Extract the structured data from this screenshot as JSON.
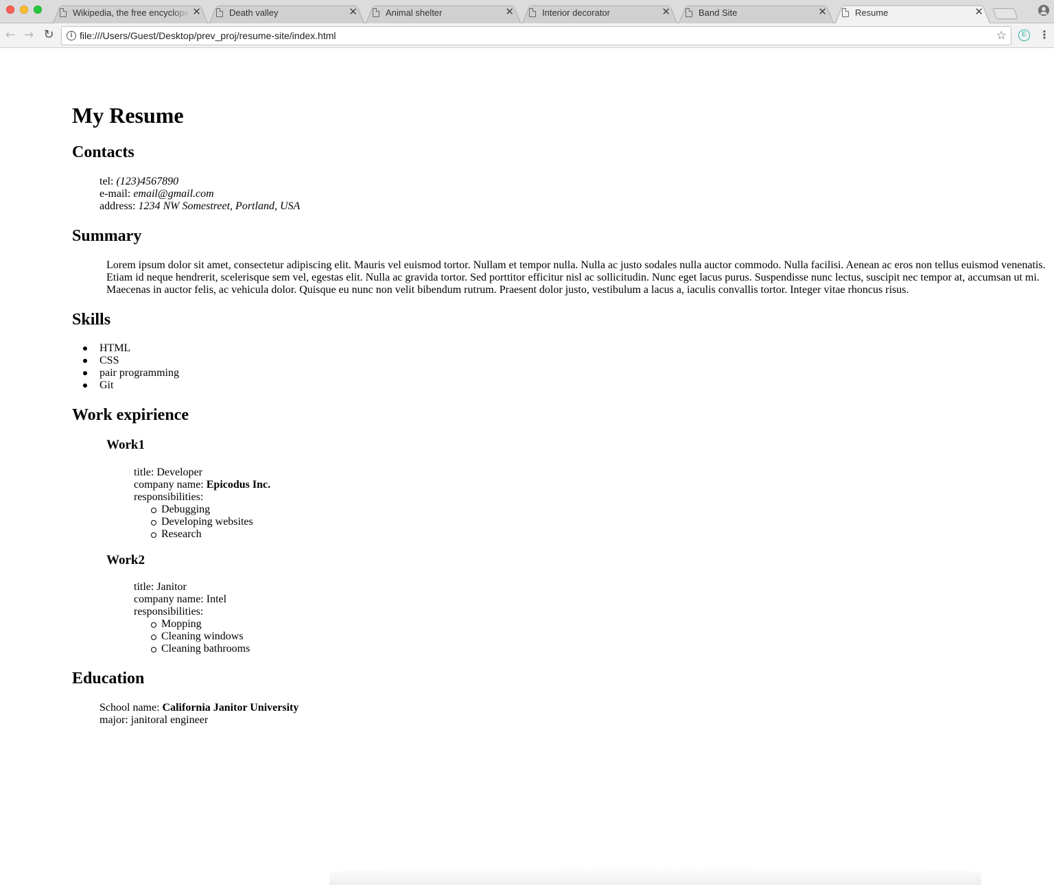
{
  "browser": {
    "tabs": [
      {
        "title": "Wikipedia, the free encyclopedia",
        "active": false
      },
      {
        "title": "Death valley",
        "active": false
      },
      {
        "title": "Animal shelter",
        "active": false
      },
      {
        "title": "Interior decorator",
        "active": false
      },
      {
        "title": "Band Site",
        "active": false
      },
      {
        "title": "Resume",
        "active": true
      }
    ],
    "close_glyph": "✕",
    "url": "file:///Users/Guest/Desktop/prev_proj/resume-site/index.html",
    "extension_letter": "E"
  },
  "resume": {
    "title": "My Resume",
    "contacts": {
      "heading": "Contacts",
      "tel_label": "tel:",
      "tel": "(123)4567890",
      "email_label": "e-mail:",
      "email": "email@gmail.com",
      "address_label": "address:",
      "address": "1234 NW Somestreet, Portland, USA"
    },
    "summary": {
      "heading": "Summary",
      "text": "Lorem ipsum dolor sit amet, consectetur adipiscing elit. Mauris vel euismod tortor. Nullam et tempor nulla. Nulla ac justo sodales nulla auctor commodo. Nulla facilisi. Aenean ac eros non tellus euismod venenatis. Etiam id neque hendrerit, scelerisque sem vel, egestas elit. Nulla ac gravida tortor. Sed porttitor efficitur nisl ac sollicitudin. Nunc eget lacus purus. Suspendisse nunc lectus, suscipit nec tempor at, accumsan ut mi. Maecenas in auctor felis, ac vehicula dolor. Quisque eu nunc non velit bibendum rutrum. Praesent dolor justo, vestibulum a lacus a, iaculis convallis tortor. Integer vitae rhoncus risus."
    },
    "skills": {
      "heading": "Skills",
      "items": [
        "HTML",
        "CSS",
        "pair programming",
        "Git"
      ]
    },
    "work": {
      "heading": "Work expirience",
      "jobs": [
        {
          "heading": "Work1",
          "title_label": "title:",
          "title": "Developer",
          "company_label": "company name:",
          "company": "Epicodus Inc.",
          "responsibilities_label": "responsibilities:",
          "responsibilities": [
            "Debugging",
            "Developing websites",
            "Research"
          ]
        },
        {
          "heading": "Work2",
          "title_label": "title:",
          "title": "Janitor",
          "company_label": "company name:",
          "company": "Intel",
          "responsibilities_label": "responsibilities:",
          "responsibilities": [
            "Mopping",
            "Cleaning windows",
            "Cleaning bathrooms"
          ]
        }
      ]
    },
    "education": {
      "heading": "Education",
      "school_label": "School name:",
      "school": "California Janitor University",
      "major_label": "major:",
      "major": "janitoral engineer"
    }
  }
}
